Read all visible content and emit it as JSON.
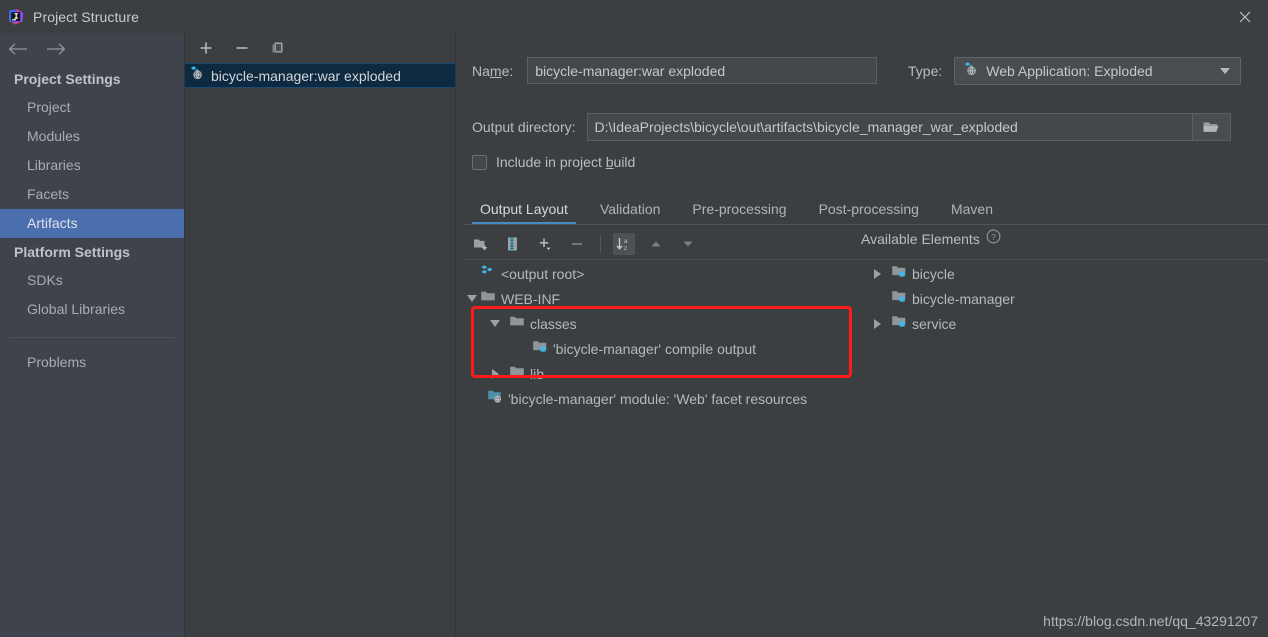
{
  "window": {
    "title": "Project Structure",
    "app_icon": "intellij-idea-icon",
    "close_icon": "close-icon"
  },
  "sidebar": {
    "back_icon": "arrow-left-icon",
    "forward_icon": "arrow-right-icon",
    "groups": [
      {
        "label": "Project Settings",
        "items": [
          {
            "label": "Project",
            "selected": false
          },
          {
            "label": "Modules",
            "selected": false
          },
          {
            "label": "Libraries",
            "selected": false
          },
          {
            "label": "Facets",
            "selected": false
          },
          {
            "label": "Artifacts",
            "selected": true
          }
        ]
      },
      {
        "label": "Platform Settings",
        "items": [
          {
            "label": "SDKs",
            "selected": false
          },
          {
            "label": "Global Libraries",
            "selected": false
          }
        ]
      }
    ],
    "problems_label": "Problems",
    "selected_color": "#4b6eaf"
  },
  "artifacts_panel": {
    "toolbar": [
      {
        "name": "add-artifact-button",
        "icon": "plus-icon"
      },
      {
        "name": "remove-artifact-button",
        "icon": "minus-icon"
      },
      {
        "name": "copy-artifact-button",
        "icon": "copy-icon"
      }
    ],
    "items": [
      {
        "label": "bicycle-manager:war exploded",
        "icon": "web-application-exploded-icon",
        "selected": true
      }
    ]
  },
  "form": {
    "name_label": "Name:",
    "name_value": "bicycle-manager:war exploded",
    "name_placeholder": "",
    "type_label": "Type:",
    "type_value": "Web Application: Exploded",
    "type_icon": "web-application-exploded-icon",
    "output_dir_label": "Output directory:",
    "output_dir_value": "D:\\IdeaProjects\\bicycle\\out\\artifacts\\bicycle_manager_war_exploded",
    "output_dir_placeholder": "",
    "browse_icon": "folder-open-icon",
    "include_in_build_label": "Include in project build",
    "include_in_build_checked": false
  },
  "tabs": [
    {
      "label": "Output Layout",
      "active": true
    },
    {
      "label": "Validation",
      "active": false
    },
    {
      "label": "Pre-processing",
      "active": false
    },
    {
      "label": "Post-processing",
      "active": false
    },
    {
      "label": "Maven",
      "active": false
    }
  ],
  "layout_toolbar": [
    {
      "name": "create-directory-button",
      "icon": "new-folder-icon",
      "boxed": false
    },
    {
      "name": "create-archive-button",
      "icon": "archive-jar-icon",
      "boxed": false
    },
    {
      "name": "add-copy-of-button",
      "icon": "plus-dropdown-icon",
      "boxed": false
    },
    {
      "name": "remove-element-button",
      "icon": "minus-icon",
      "boxed": false
    },
    {
      "name": "sort-elements-button",
      "icon": "sort-az-icon",
      "boxed": true
    },
    {
      "name": "move-up-button",
      "icon": "triangle-up-icon",
      "boxed": false
    },
    {
      "name": "move-down-button",
      "icon": "triangle-down-icon",
      "boxed": false
    }
  ],
  "output_tree": [
    {
      "label": "<output root>",
      "icon": "output-root-icon",
      "indent": 0,
      "twist": "none"
    },
    {
      "label": "WEB-INF",
      "icon": "folder-icon",
      "indent": 0,
      "twist": "down"
    },
    {
      "label": "classes",
      "icon": "folder-icon",
      "indent": 1,
      "twist": "down"
    },
    {
      "label": "'bicycle-manager' compile output",
      "icon": "module-output-icon",
      "indent": 2,
      "twist": "none"
    },
    {
      "label": "lib",
      "icon": "folder-icon",
      "indent": 1,
      "twist": "right"
    },
    {
      "label": "'bicycle-manager' module: 'Web' facet resources",
      "icon": "web-facet-resources-icon",
      "indent": 0,
      "twist": "none"
    }
  ],
  "available_elements": {
    "header": "Available Elements",
    "help_icon": "help-circle-icon",
    "items": [
      {
        "label": "bicycle",
        "icon": "module-output-icon",
        "twist": "right"
      },
      {
        "label": "bicycle-manager",
        "icon": "module-output-icon",
        "twist": "none"
      },
      {
        "label": "service",
        "icon": "module-output-icon",
        "twist": "right"
      }
    ]
  },
  "annotation": {
    "highlight_color": "#ff1a1a"
  },
  "watermark": "https://blog.csdn.net/qq_43291207"
}
